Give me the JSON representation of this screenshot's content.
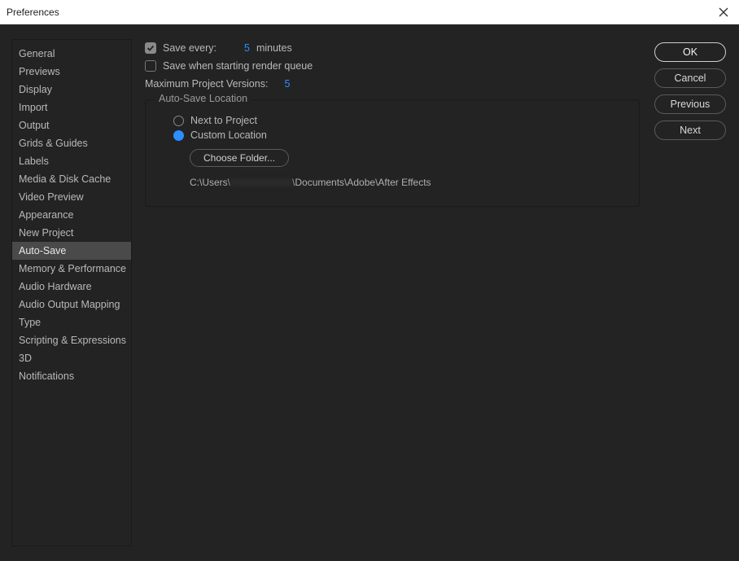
{
  "window": {
    "title": "Preferences"
  },
  "sidebar": {
    "items": [
      {
        "label": "General"
      },
      {
        "label": "Previews"
      },
      {
        "label": "Display"
      },
      {
        "label": "Import"
      },
      {
        "label": "Output"
      },
      {
        "label": "Grids & Guides"
      },
      {
        "label": "Labels"
      },
      {
        "label": "Media & Disk Cache"
      },
      {
        "label": "Video Preview"
      },
      {
        "label": "Appearance"
      },
      {
        "label": "New Project"
      },
      {
        "label": "Auto-Save",
        "selected": true
      },
      {
        "label": "Memory & Performance"
      },
      {
        "label": "Audio Hardware"
      },
      {
        "label": "Audio Output Mapping"
      },
      {
        "label": "Type"
      },
      {
        "label": "Scripting & Expressions"
      },
      {
        "label": "3D"
      },
      {
        "label": "Notifications"
      }
    ]
  },
  "main": {
    "save_every": {
      "checked": true,
      "label_before": "Save every:",
      "value": "5",
      "label_after": "minutes"
    },
    "save_render_queue": {
      "checked": false,
      "label": "Save when starting render queue"
    },
    "max_versions": {
      "label": "Maximum Project Versions:",
      "value": "5"
    },
    "location": {
      "legend": "Auto-Save Location",
      "radios": {
        "next_to_project": {
          "label": "Next to Project",
          "selected": false
        },
        "custom": {
          "label": "Custom Location",
          "selected": true
        }
      },
      "choose_folder": "Choose Folder...",
      "path_prefix": "C:\\Users\\",
      "path_suffix": "\\Documents\\Adobe\\After Effects"
    }
  },
  "buttons": {
    "ok": "OK",
    "cancel": "Cancel",
    "previous": "Previous",
    "next": "Next"
  }
}
